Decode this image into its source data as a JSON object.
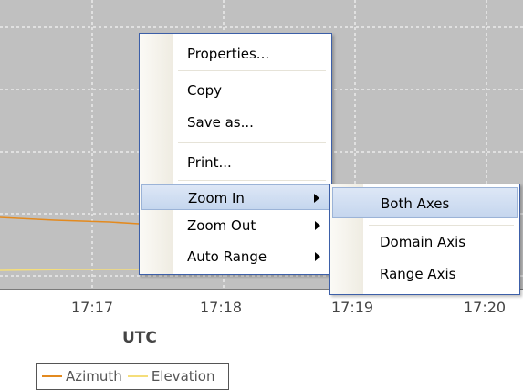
{
  "chart": {
    "x_ticks": [
      "17:17",
      "17:18",
      "17:19",
      "17:20"
    ],
    "x_title": "UTC",
    "legend": [
      {
        "label": "Azimuth",
        "color": "#e38a1f"
      },
      {
        "label": "Elevation",
        "color": "#f5de7a"
      }
    ],
    "plot_background": "#c0c0c0",
    "gridline_style": "dashed white"
  },
  "context_menu": {
    "items": [
      {
        "label": "Properties..."
      },
      {
        "label": "Copy"
      },
      {
        "label": "Save as..."
      },
      {
        "label": "Print..."
      },
      {
        "label": "Zoom In",
        "submenu": true,
        "highlighted": true
      },
      {
        "label": "Zoom Out",
        "submenu": true
      },
      {
        "label": "Auto Range",
        "submenu": true
      }
    ]
  },
  "zoom_in_submenu": {
    "items": [
      {
        "label": "Both Axes",
        "highlighted": true
      },
      {
        "label": "Domain Axis"
      },
      {
        "label": "Range Axis"
      }
    ]
  },
  "colors": {
    "menu_border": "#3c5fa8",
    "highlight": "#c5d6ee"
  }
}
